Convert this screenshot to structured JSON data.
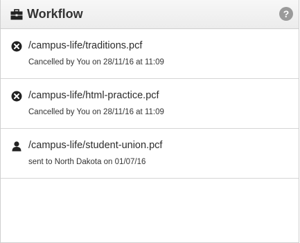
{
  "panel": {
    "title": "Workflow",
    "title_icon": "briefcase-icon",
    "help_icon": "question-circle-icon",
    "help_symbol": "?"
  },
  "items": [
    {
      "icon": "cancel-circle-icon",
      "path": "/campus-life/traditions.pcf",
      "status": "Cancelled by You on 28/11/16 at 11:09"
    },
    {
      "icon": "cancel-circle-icon",
      "path": "/campus-life/html-practice.pcf",
      "status": "Cancelled by You on 28/11/16 at 11:09"
    },
    {
      "icon": "user-icon",
      "path": "/campus-life/student-union.pcf",
      "status": "sent to North Dakota on 01/07/16"
    }
  ],
  "colors": {
    "header_bg": "#ececec",
    "border": "#cfcfcf",
    "icon": "#222222",
    "help_bg": "#9a9a9a"
  }
}
